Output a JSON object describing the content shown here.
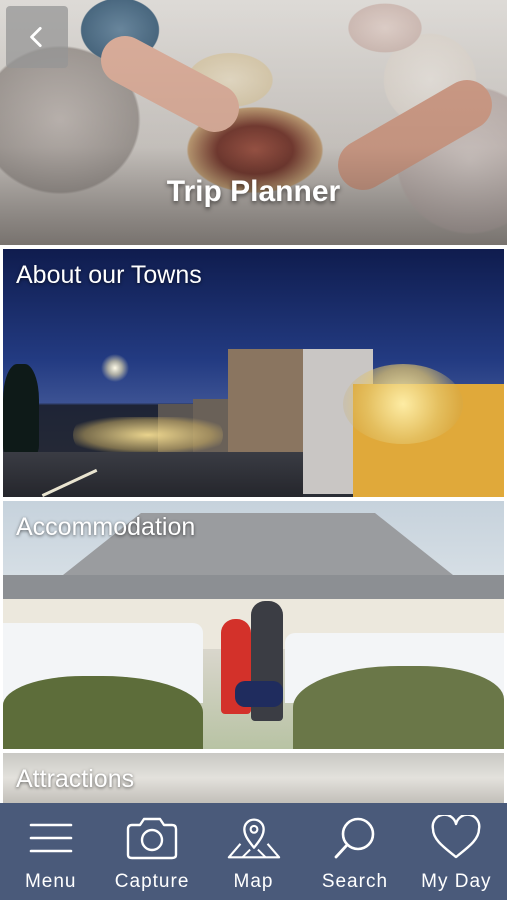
{
  "header": {
    "title": "Trip Planner",
    "back_icon": "chevron-left-icon"
  },
  "tiles": [
    {
      "label": "About our Towns"
    },
    {
      "label": "Accommodation"
    },
    {
      "label": "Attractions"
    }
  ],
  "bottom_nav": {
    "items": [
      {
        "label": "Menu",
        "icon": "hamburger-menu-icon"
      },
      {
        "label": "Capture",
        "icon": "camera-icon"
      },
      {
        "label": "Map",
        "icon": "map-pin-icon"
      },
      {
        "label": "Search",
        "icon": "search-icon"
      },
      {
        "label": "My Day",
        "icon": "heart-icon"
      }
    ]
  },
  "colors": {
    "nav_background": "#4a5a7a",
    "text": "#ffffff"
  }
}
